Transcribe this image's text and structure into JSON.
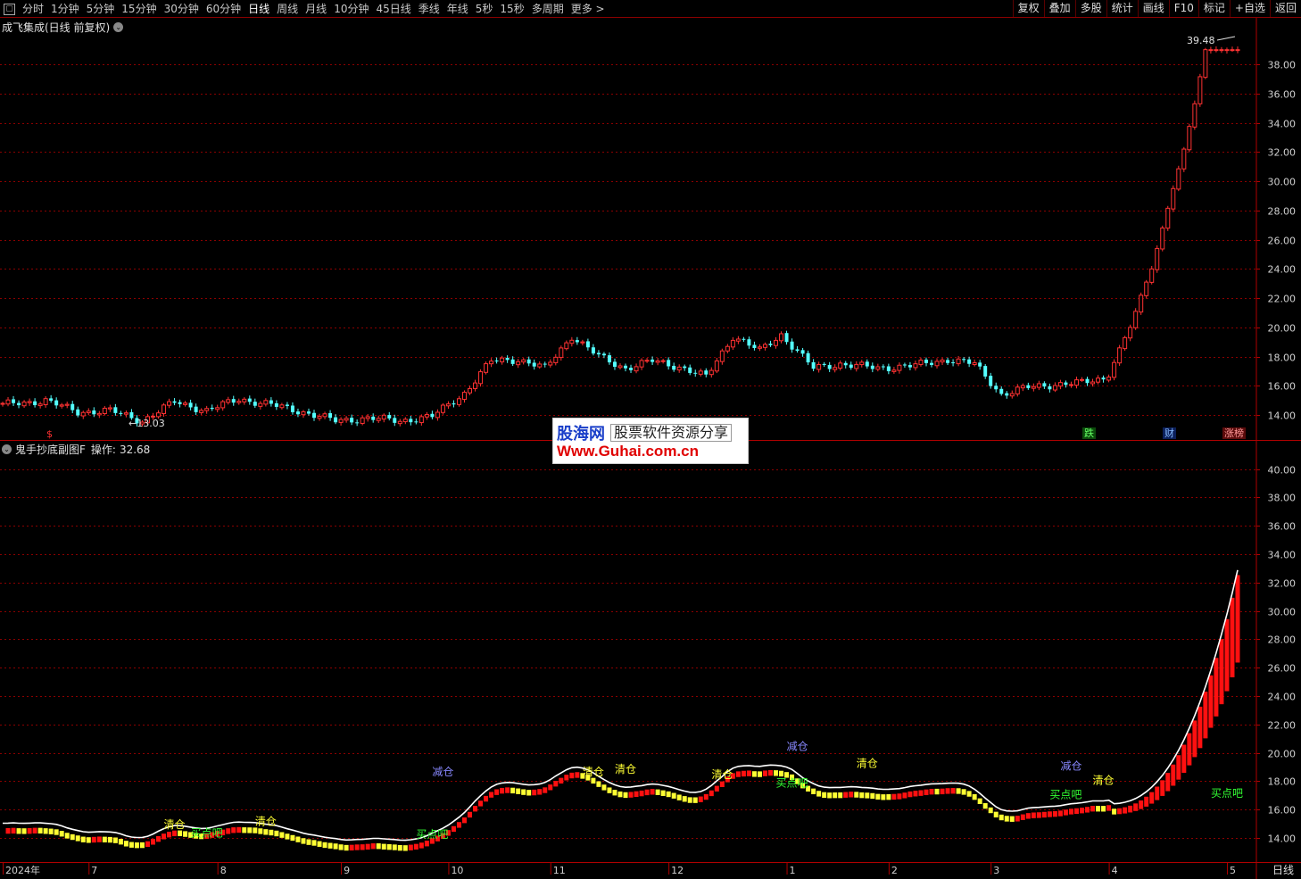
{
  "toolbar": {
    "left_items": [
      {
        "label": "分时",
        "active": false
      },
      {
        "label": "1分钟",
        "active": false
      },
      {
        "label": "5分钟",
        "active": false
      },
      {
        "label": "15分钟",
        "active": false
      },
      {
        "label": "30分钟",
        "active": false
      },
      {
        "label": "60分钟",
        "active": false
      },
      {
        "label": "日线",
        "active": true
      },
      {
        "label": "周线",
        "active": false
      },
      {
        "label": "月线",
        "active": false
      },
      {
        "label": "10分钟",
        "active": false
      },
      {
        "label": "45日线",
        "active": false
      },
      {
        "label": "季线",
        "active": false
      },
      {
        "label": "年线",
        "active": false
      },
      {
        "label": "5秒",
        "active": false
      },
      {
        "label": "15秒",
        "active": false
      },
      {
        "label": "多周期",
        "active": false
      },
      {
        "label": "更多 >",
        "active": false
      }
    ],
    "right_items": [
      "复权",
      "叠加",
      "多股",
      "统计",
      "画线",
      "F10",
      "标记",
      "+自选",
      "返回"
    ]
  },
  "main_panel": {
    "title": "成飞集成(日线 前复权)"
  },
  "sub_panel": {
    "title": "鬼手抄底副图F",
    "value_label": "操作:",
    "value": "32.68"
  },
  "watermark": {
    "brand": "股海网",
    "slogan": "股票软件资源分享",
    "url": "Www.Guhai.com.cn"
  },
  "marks": {
    "die": "跌",
    "cai": "财",
    "zhang": "涨榜",
    "dollar": "$"
  },
  "period_label": "日线",
  "colors": {
    "up": "#ff3232",
    "down": "#54ffff",
    "grid": "#8b0000",
    "signal_buy": "#33ff33",
    "signal_clear": "#ffff33",
    "signal_reduce": "#8888ff"
  },
  "chart_data": [
    {
      "type": "candlestick",
      "title": "成飞集成(日线 前复权)",
      "y_ticks": [
        14.0,
        16.0,
        18.0,
        20.0,
        22.0,
        24.0,
        26.0,
        28.0,
        30.0,
        32.0,
        34.0,
        36.0,
        38.0
      ],
      "ylim": [
        12.3,
        40.2
      ],
      "max_label": "39.48",
      "min_label": "13.03",
      "grid": true,
      "waypoints": [
        [
          0,
          14.7
        ],
        [
          8,
          15.0
        ],
        [
          14,
          14.2
        ],
        [
          20,
          14.3
        ],
        [
          26,
          13.6
        ],
        [
          32,
          14.9
        ],
        [
          38,
          14.3
        ],
        [
          44,
          15.1
        ],
        [
          50,
          14.7
        ],
        [
          56,
          14.2
        ],
        [
          62,
          13.6
        ],
        [
          68,
          13.8
        ],
        [
          74,
          13.6
        ],
        [
          80,
          13.9
        ],
        [
          86,
          15.5
        ],
        [
          91,
          17.7
        ],
        [
          96,
          17.8
        ],
        [
          101,
          17.2
        ],
        [
          106,
          19.4
        ],
        [
          111,
          18.0
        ],
        [
          116,
          17.2
        ],
        [
          121,
          17.7
        ],
        [
          126,
          17.3
        ],
        [
          131,
          16.6
        ],
        [
          136,
          19.4
        ],
        [
          141,
          18.4
        ],
        [
          145,
          19.5
        ],
        [
          151,
          17.2
        ],
        [
          156,
          17.5
        ],
        [
          163,
          17.2
        ],
        [
          170,
          17.4
        ],
        [
          176,
          17.8
        ],
        [
          181,
          17.5
        ],
        [
          186,
          15.4
        ],
        [
          191,
          15.9
        ],
        [
          196,
          16.1
        ],
        [
          201,
          16.2
        ],
        [
          206,
          16.6
        ],
        [
          208,
          18.6
        ],
        [
          210,
          20.0
        ],
        [
          212,
          22.2
        ],
        [
          214,
          24.0
        ],
        [
          216,
          26.8
        ],
        [
          218,
          29.5
        ],
        [
          220,
          32.2
        ],
        [
          222,
          35.3
        ],
        [
          224,
          39.0
        ]
      ]
    },
    {
      "type": "line+bar",
      "title": "鬼手抄底副图F",
      "y_ticks": [
        14.0,
        16.0,
        18.0,
        20.0,
        22.0,
        24.0,
        26.0,
        28.0,
        30.0,
        32.0,
        34.0,
        36.0,
        38.0,
        40.0
      ],
      "ylim": [
        12.3,
        41.3
      ],
      "series": [
        {
          "name": "操作",
          "last": 32.68
        }
      ],
      "signals": [
        {
          "label": "清仓",
          "kind": "clear",
          "i": 32,
          "v": 14.7
        },
        {
          "label": "买点吧",
          "kind": "buy",
          "i": 38,
          "v": 14.1
        },
        {
          "label": "清仓",
          "kind": "clear",
          "i": 49,
          "v": 14.9
        },
        {
          "label": "减仓",
          "kind": "reduce",
          "i": 82,
          "v": 18.4
        },
        {
          "label": "买点吧",
          "kind": "buy",
          "i": 80,
          "v": 14.0
        },
        {
          "label": "清仓",
          "kind": "clear",
          "i": 110,
          "v": 18.4
        },
        {
          "label": "清仓",
          "kind": "clear",
          "i": 116,
          "v": 18.6
        },
        {
          "label": "清仓",
          "kind": "clear",
          "i": 134,
          "v": 18.2
        },
        {
          "label": "减仓",
          "kind": "reduce",
          "i": 148,
          "v": 20.2
        },
        {
          "label": "买点吧",
          "kind": "buy",
          "i": 147,
          "v": 17.6
        },
        {
          "label": "清仓",
          "kind": "clear",
          "i": 161,
          "v": 19.0
        },
        {
          "label": "减仓",
          "kind": "reduce",
          "i": 199,
          "v": 18.8
        },
        {
          "label": "买点吧",
          "kind": "buy",
          "i": 198,
          "v": 16.8
        },
        {
          "label": "清仓",
          "kind": "clear",
          "i": 205,
          "v": 17.8
        },
        {
          "label": "买点吧",
          "kind": "buy",
          "i": 228,
          "v": 16.9
        }
      ]
    }
  ],
  "x_axis": {
    "labels": [
      {
        "text": "2024年",
        "i": 0
      },
      {
        "text": "7",
        "i": 16
      },
      {
        "text": "8",
        "i": 40
      },
      {
        "text": "9",
        "i": 63
      },
      {
        "text": "10",
        "i": 83
      },
      {
        "text": "11",
        "i": 102
      },
      {
        "text": "12",
        "i": 124
      },
      {
        "text": "1",
        "i": 146
      },
      {
        "text": "2",
        "i": 165
      },
      {
        "text": "3",
        "i": 184
      },
      {
        "text": "4",
        "i": 206
      },
      {
        "text": "5",
        "i": 228
      }
    ]
  }
}
